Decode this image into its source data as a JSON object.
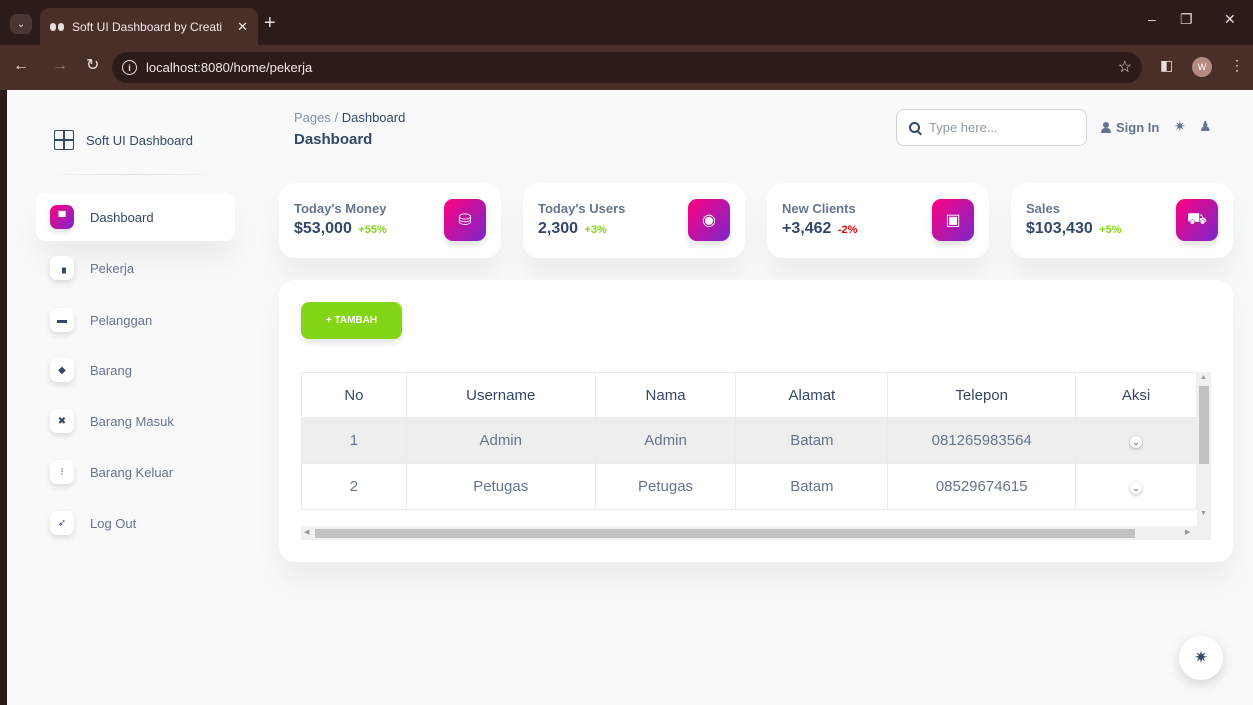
{
  "browser": {
    "tab_title": "Soft UI Dashboard by Creative T",
    "tab_close": "✕",
    "new_tab": "+",
    "url": "localhost:8080/home/pekerja",
    "profile_initial": "W"
  },
  "sidebar": {
    "brand": "Soft UI Dashboard",
    "items": [
      {
        "label": "Dashboard",
        "icon": "store-icon",
        "glyph": "▀",
        "active": true
      },
      {
        "label": "Pekerja",
        "icon": "chart-bars-icon",
        "glyph": "▗",
        "active": false
      },
      {
        "label": "Pelanggan",
        "icon": "credit-card-icon",
        "glyph": "▬",
        "active": false
      },
      {
        "label": "Barang",
        "icon": "box-icon",
        "glyph": "◆",
        "active": false
      },
      {
        "label": "Barang Masuk",
        "icon": "tools-icon",
        "glyph": "✖",
        "active": false
      },
      {
        "label": "Barang Keluar",
        "icon": "user-plus-icon",
        "glyph": "⁝",
        "active": false
      },
      {
        "label": "Log Out",
        "icon": "rocket-icon",
        "glyph": "➶",
        "active": false
      }
    ]
  },
  "header": {
    "breadcrumb_root": "Pages",
    "breadcrumb_sep": " / ",
    "breadcrumb_current": "Dashboard",
    "title": "Dashboard",
    "search_placeholder": "Type here...",
    "signin_label": "Sign In"
  },
  "cards": [
    {
      "label": "Today's Money",
      "value": "$53,000",
      "change": "+55%",
      "change_color": "#82d616",
      "icon": "money-icon",
      "glyph": "⛁"
    },
    {
      "label": "Today's Users",
      "value": "2,300",
      "change": "+3%",
      "change_color": "#82d616",
      "icon": "globe-icon",
      "glyph": "◉"
    },
    {
      "label": "New Clients",
      "value": "+3,462",
      "change": "-2%",
      "change_color": "#ea0606",
      "icon": "document-icon",
      "glyph": "▣"
    },
    {
      "label": "Sales",
      "value": "$103,430",
      "change": "+5%",
      "change_color": "#82d616",
      "icon": "cart-icon",
      "glyph": "⛟"
    }
  ],
  "table": {
    "add_button": "+ TAMBAH",
    "columns": [
      "No",
      "Username",
      "Nama",
      "Alamat",
      "Telepon",
      "Aksi"
    ],
    "rows": [
      [
        "1",
        "Admin",
        "Admin",
        "Batam",
        "081265983564"
      ],
      [
        "2",
        "Petugas",
        "Petugas",
        "Batam",
        "08529674615"
      ]
    ],
    "aksi_glyph": "⌄"
  },
  "colors": {
    "accent_gradient_start": "#7928ca",
    "accent_gradient_end": "#ff0080",
    "success": "#82d616",
    "danger": "#ea0606"
  }
}
